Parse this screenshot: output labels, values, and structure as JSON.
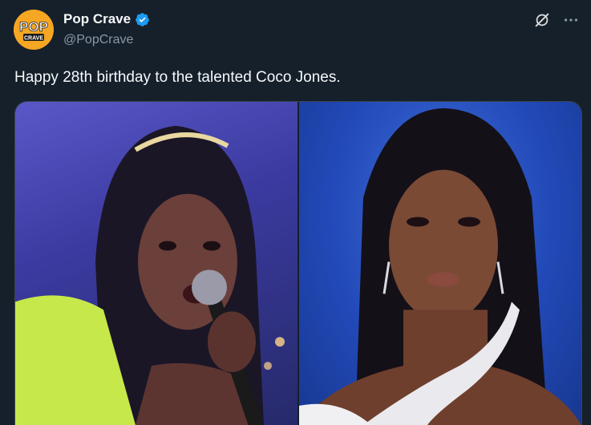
{
  "account": {
    "display_name": "Pop Crave",
    "handle": "@PopCrave",
    "verified": true,
    "avatar_text_top": "POP",
    "avatar_text_bottom": "CRAVE",
    "avatar_color": "#f5a623"
  },
  "tweet": {
    "text": "Happy 28th birthday to the talented Coco Jones."
  },
  "actions": {
    "grok_icon": "grok-icon",
    "more_icon": "more-icon"
  },
  "media": {
    "count": 2,
    "photos": [
      "photo-left",
      "photo-right"
    ]
  },
  "colors": {
    "background": "#15202b",
    "text": "#f7f9f9",
    "secondary": "#8b98a5",
    "verified_blue": "#1d9bf0"
  }
}
